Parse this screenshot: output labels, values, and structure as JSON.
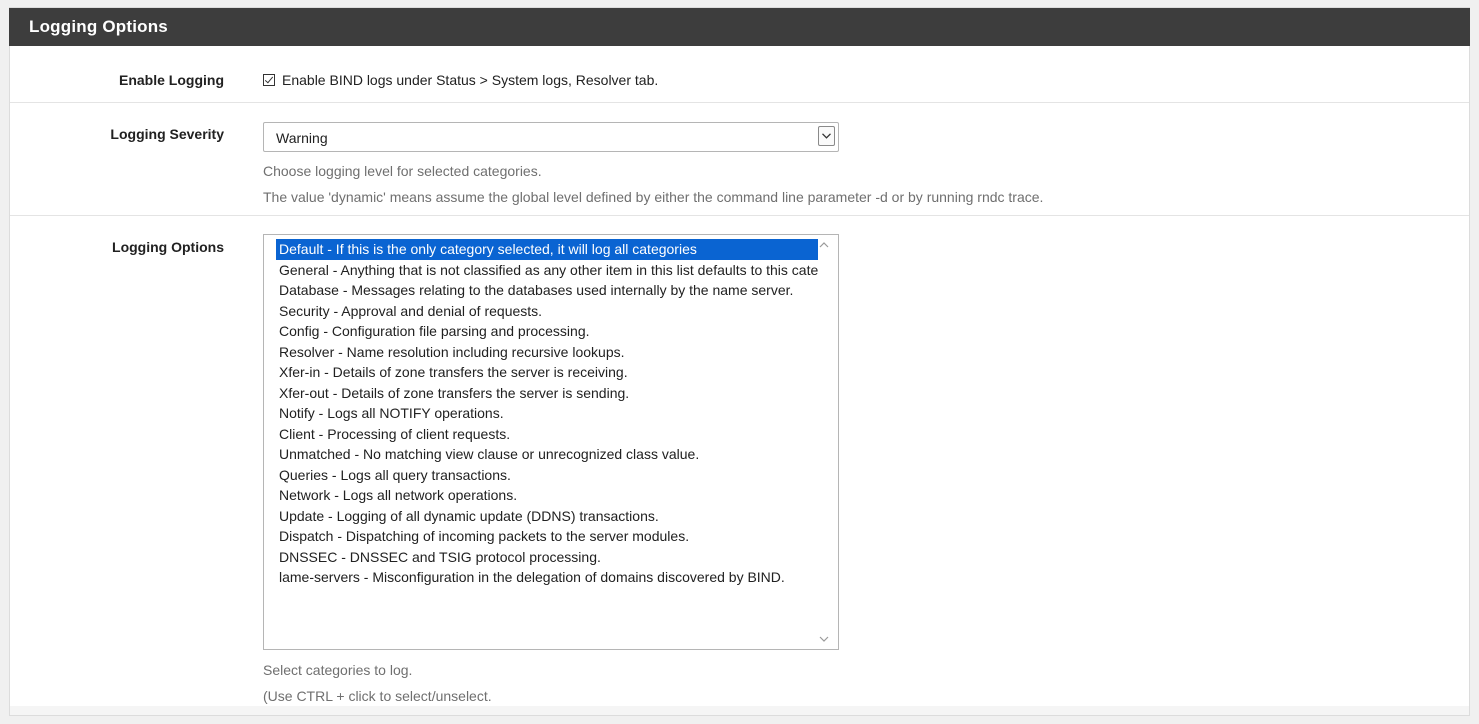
{
  "section": {
    "title": "Logging Options"
  },
  "enable_logging": {
    "label": "Enable Logging",
    "checked": true,
    "description": "Enable BIND logs under Status > System logs, Resolver tab."
  },
  "severity": {
    "label": "Logging Severity",
    "value": "Warning",
    "help_line1": "Choose logging level for selected categories.",
    "help_line2": "The value 'dynamic' means assume the global level defined by either the command line parameter -d or by running rndc trace."
  },
  "options": {
    "label": "Logging Options",
    "items": [
      "Default - If this is the only category selected, it will log all categories",
      "General - Anything that is not classified as any other item in this list defaults to this category.",
      "Database - Messages relating to the databases used internally by the name server.",
      "Security - Approval and denial of requests.",
      "Config - Configuration file parsing and processing.",
      "Resolver - Name resolution including recursive lookups.",
      "Xfer-in - Details of zone transfers the server is receiving.",
      "Xfer-out - Details of zone transfers the server is sending.",
      "Notify - Logs all NOTIFY operations.",
      "Client - Processing of client requests.",
      "Unmatched - No matching view clause or unrecognized class value.",
      "Queries - Logs all query transactions.",
      "Network - Logs all network operations.",
      "Update - Logging of all dynamic update (DDNS) transactions.",
      "Dispatch - Dispatching of incoming packets to the server modules.",
      "DNSSEC - DNSSEC and TSIG protocol processing.",
      "lame-servers - Misconfiguration in the delegation of domains discovered by BIND."
    ],
    "selected_index": 0,
    "help_line1": "Select categories to log.",
    "help_line2": "(Use CTRL + click to select/unselect."
  },
  "colors": {
    "header_bg": "#3d3d3d",
    "selection_bg": "#0a64d2",
    "help_text": "#6f6f6f"
  },
  "icons": {
    "checkbox": "checkbox-checked-icon",
    "dropdown": "chevron-down-icon",
    "scroll_up": "chevron-up-icon",
    "scroll_down": "chevron-down-icon"
  }
}
